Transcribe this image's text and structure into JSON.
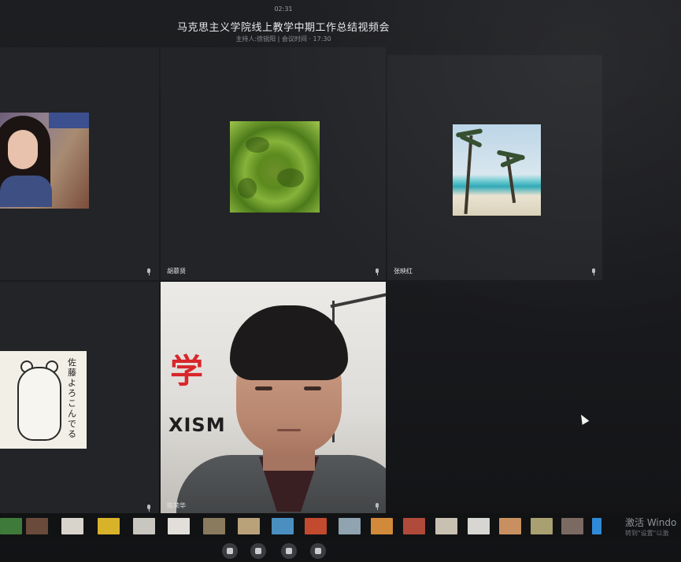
{
  "header": {
    "timer": "02:31",
    "title": "马克思主义学院线上教学中期工作总结视频会",
    "subtitle": "主持人:徐锐阳 | 会议时间 · 17:30"
  },
  "tiles": [
    {
      "name": ""
    },
    {
      "name": "胡慕贤"
    },
    {
      "name": "张映红"
    },
    {
      "name": ""
    },
    {
      "name": "陈荣华"
    }
  ],
  "video": {
    "wall_text_cn": "学",
    "wall_text_en": "XISM"
  },
  "thumbs": {
    "bear_text": "佐藤よろこんでる"
  },
  "watermark": {
    "line1": "激活 Windo",
    "line2": "转到\"设置\"以激"
  },
  "colors": {
    "background": "#17181b",
    "tile": "#232427",
    "accent_red": "#d8262a"
  }
}
